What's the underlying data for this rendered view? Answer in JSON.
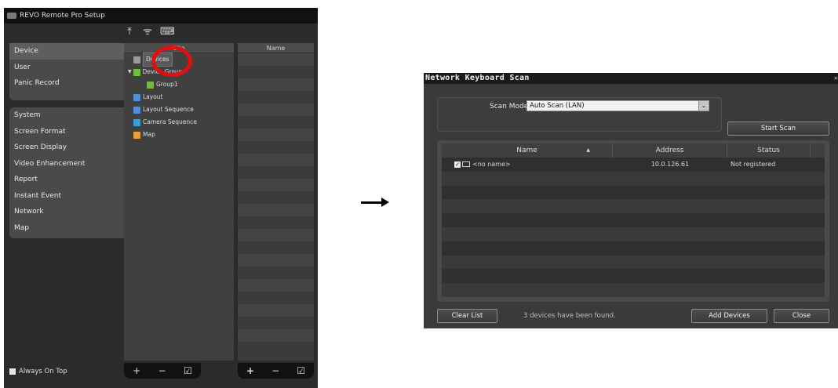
{
  "setup_window": {
    "title": "REVO Remote Pro Setup",
    "toolbar_icons": [
      "upload-icon",
      "wireless-icon",
      "keyboard-icon"
    ],
    "menu_top": [
      "Device",
      "User",
      "Panic Record"
    ],
    "menu_bottom": [
      "System",
      "Screen Format",
      "Screen Display",
      "Video Enhancement",
      "Report",
      "Instant Event",
      "Network",
      "Map"
    ],
    "selected_menu": "Device",
    "site_header": "Site",
    "name_header": "Name",
    "tree": {
      "devices": "Devices",
      "device_group": "Device Group",
      "group1": "Group1",
      "layout": "Layout",
      "layout_sequence": "Layout Sequence",
      "camera_sequence": "Camera Sequence",
      "map": "Map"
    },
    "ctrl_symbols": {
      "add": "+",
      "remove": "−",
      "edit": "☑"
    },
    "always_on_top": "Always On Top"
  },
  "scan_dialog": {
    "title": "Network Keyboard Scan",
    "scan_mode_label": "Scan Mode :",
    "scan_mode_value": "Auto Scan (LAN)",
    "start_scan": "Start Scan",
    "columns": {
      "name": "Name",
      "address": "Address",
      "status": "Status"
    },
    "rows": [
      {
        "checked": true,
        "name": "<no name>",
        "address": "10.0.126.61",
        "status": "Not registered"
      }
    ],
    "clear_list": "Clear List",
    "found_message": "3 devices have been found.",
    "add_devices": "Add Devices",
    "close": "Close"
  },
  "colors": {
    "highlight": "#e01010",
    "window_bg": "#2b2b2b"
  }
}
